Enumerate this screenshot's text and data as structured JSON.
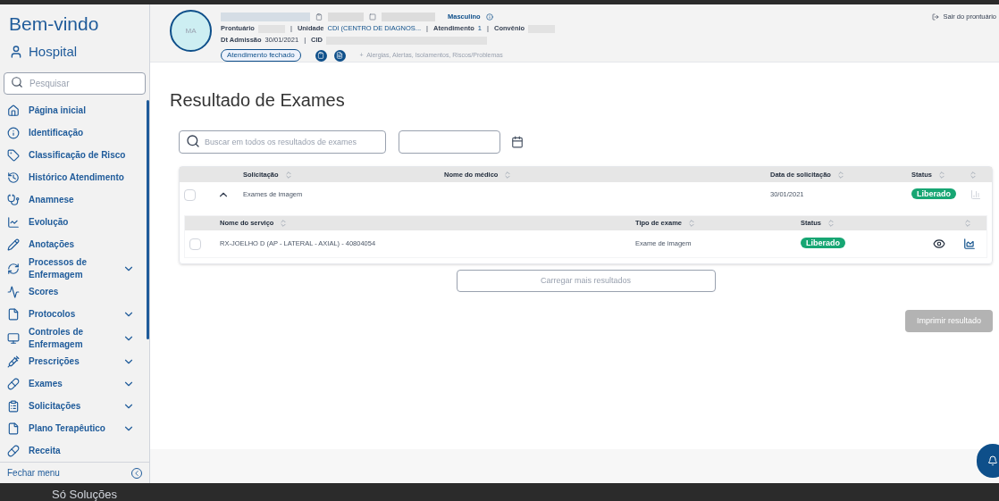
{
  "sidebar": {
    "title": "Bem-vindo",
    "user": "Hospital",
    "search": {
      "placeholder": "Pesquisar"
    },
    "items": [
      {
        "label": "Página inicial",
        "expandable": false
      },
      {
        "label": "Identificação",
        "expandable": false
      },
      {
        "label": "Classificação de Risco",
        "expandable": false
      },
      {
        "label": "Histórico Atendimento",
        "expandable": false
      },
      {
        "label": "Anamnese",
        "expandable": false
      },
      {
        "label": "Evolução",
        "expandable": false
      },
      {
        "label": "Anotações",
        "expandable": false
      },
      {
        "label": "Processos de Enfermagem",
        "expandable": true
      },
      {
        "label": "Scores",
        "expandable": false
      },
      {
        "label": "Protocolos",
        "expandable": true
      },
      {
        "label": "Controles de Enfermagem",
        "expandable": true
      },
      {
        "label": "Prescrições",
        "expandable": true
      },
      {
        "label": "Exames",
        "expandable": true
      },
      {
        "label": "Solicitações",
        "expandable": true
      },
      {
        "label": "Plano Terapêutico",
        "expandable": true
      },
      {
        "label": "Receita",
        "expandable": false
      }
    ],
    "footer": "Fechar menu"
  },
  "patient": {
    "initials": "MA",
    "sex": "Masculino",
    "line2": [
      {
        "label": "Prontuário"
      },
      {
        "sep": "|",
        "label": "Unidade",
        "value": "CDI (CENTRO DE DIAGNOS..."
      },
      {
        "sep": "|",
        "label": "Atendimento",
        "value": "1"
      },
      {
        "sep": "|",
        "label": "Convênio"
      }
    ],
    "line3": [
      {
        "label": "Dt Admissão",
        "value": "30/01/2021"
      },
      {
        "sep": "|",
        "label": "CID"
      }
    ],
    "status_chip": "Atendimento fechado",
    "alerts": "+  Alergias, Alertas, Isolamentos, Riscos/Problemas",
    "exit": "Sair do prontuário"
  },
  "page": {
    "title": "Resultado de Exames",
    "search": {
      "placeholder": "Buscar em todos os resultados de exames"
    }
  },
  "table": {
    "columns": [
      "Solicitação",
      "Nome do médico",
      "Data de solicitação",
      "Status"
    ],
    "rows": [
      {
        "checked": false,
        "expanded": true,
        "name": "Exames de imagem",
        "date": "30/01/2021",
        "status": "Liberado",
        "sub_columns": [
          "Nome do serviço",
          "Tipo de exame",
          "Status"
        ],
        "children": [
          {
            "checked": false,
            "name": "RX-JOELHO D (AP - LATERAL - AXIAL) - 40804054",
            "type": "Exame de imagem",
            "status": "Liberado"
          }
        ]
      }
    ]
  },
  "load_more": "Carregar mais resultados",
  "print": {
    "label": "Imprimir resultado",
    "disabled": true
  },
  "taskbar": {
    "label": "Só Soluções"
  }
}
